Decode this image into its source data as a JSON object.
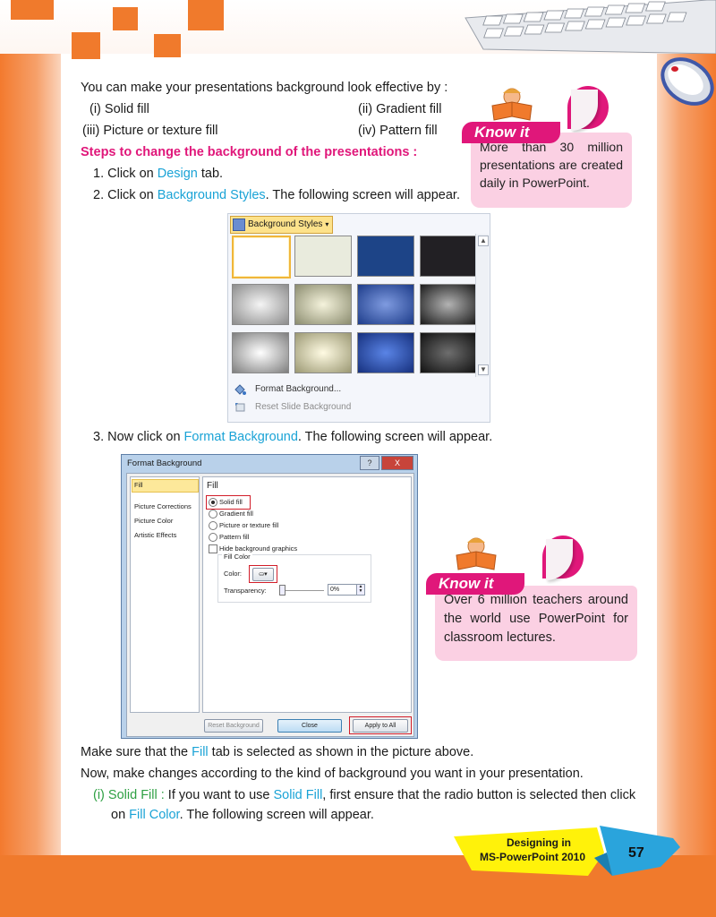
{
  "intro": "You can make your presentations background look effective by :",
  "options": [
    "(i)  Solid fill",
    "(ii)  Gradient fill",
    "(iii)  Picture or texture fill",
    "(iv) Pattern fill"
  ],
  "steps_heading": "Steps to change the background of the presentations :",
  "steps": {
    "s1_pre": "1.  Click on ",
    "s1_link": "Design",
    "s1_post": " tab.",
    "s2_pre": "2.  Click on ",
    "s2_link": "Background Styles",
    "s2_post": ". The following screen will appear.",
    "s3_pre": "3.  Now click on ",
    "s3_link": "Format Background",
    "s3_post": ". The following screen will appear."
  },
  "know1": {
    "title": "Know it",
    "text": "More than 30 million presentations are created daily in PowerPoint."
  },
  "know2": {
    "title": "Know it",
    "text": "Over 6 million teachers around the world use PowerPoint for classroom lectures."
  },
  "gallery": {
    "button_label": "Background Styles",
    "menu_format": "Format Background...",
    "menu_reset": "Reset Slide Background",
    "swatches": [
      {
        "type": "solid",
        "c1": "#ffffff"
      },
      {
        "type": "solid",
        "c1": "#e9ebdd"
      },
      {
        "type": "solid",
        "c1": "#1d4487"
      },
      {
        "type": "solid",
        "c1": "#222024"
      },
      {
        "type": "radial",
        "c1": "#f5f5f5",
        "c2": "#8c8c8c"
      },
      {
        "type": "radial",
        "c1": "#f5f3dc",
        "c2": "#8b8c6f"
      },
      {
        "type": "radial",
        "c1": "#7f9be0",
        "c2": "#1d3c8a"
      },
      {
        "type": "radial",
        "c1": "#b3b3b3",
        "c2": "#1b1b1b"
      },
      {
        "type": "radial",
        "c1": "#ffffff",
        "c2": "#7e7e7e"
      },
      {
        "type": "radial",
        "c1": "#fffbe3",
        "c2": "#9b9873"
      },
      {
        "type": "radial",
        "c1": "#5a84e6",
        "c2": "#16307d"
      },
      {
        "type": "radial",
        "c1": "#6e6e6e",
        "c2": "#111111"
      }
    ]
  },
  "dialog": {
    "title": "Format Background",
    "close": "X",
    "help": "?",
    "left_items": [
      "Fill",
      "Picture Corrections",
      "Picture Color",
      "Artistic Effects"
    ],
    "panel_title": "Fill",
    "radio_solid": "Solid fill",
    "radio_gradient": "Gradient fill",
    "radio_picture": "Picture or texture fill",
    "radio_pattern": "Pattern fill",
    "hide_graphics": "Hide background graphics",
    "fill_color": "Fill Color",
    "color_label": "Color:",
    "transparency_label": "Transparency:",
    "transparency_value": "0%",
    "reset_button": "Reset Background",
    "close_button": "Close",
    "apply_button": "Apply to All"
  },
  "after": {
    "line1_pre": "Make sure that the ",
    "line1_link": "Fill",
    "line1_post": " tab is selected as shown in the picture above.",
    "line2": "Now, make changes according to the kind of background you want in your presentation.",
    "line3_num": "(i)  ",
    "line3_lead": "Solid Fill :",
    "line3_mid": " If you want to use ",
    "line3_link": "Solid Fill",
    "line3_post": ", first ensure that the radio button is selected then click",
    "line4_pre": "on ",
    "line4_link": "Fill Color",
    "line4_post": ". The following screen will appear."
  },
  "footer": {
    "line1": "Designing in",
    "line2": "MS-PowerPoint 2010",
    "page": "57"
  },
  "colors": {
    "orange": "#f07a2c",
    "pink": "#e0177a",
    "link": "#1aa3d6",
    "green": "#2ea043"
  }
}
